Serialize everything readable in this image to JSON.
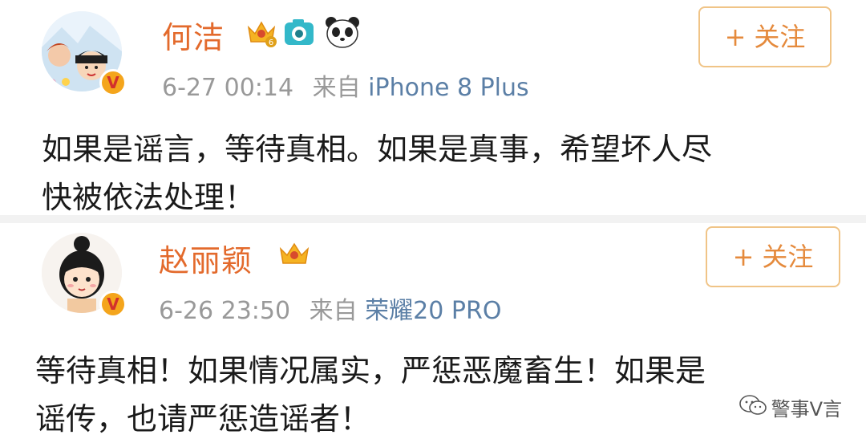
{
  "posts": [
    {
      "name": "何洁",
      "time": "6-27 00:14",
      "source_prefix": "来自",
      "source": "iPhone 8 Plus",
      "follow_label": "关注",
      "content_line1": "如果是谣言，等待真相。如果是真事，希望坏人尽",
      "content_line2": "快被依法处理！",
      "badges": [
        "crown-level-badge",
        "camera-badge",
        "panda-badge"
      ]
    },
    {
      "name": "赵丽颖",
      "time": "6-26 23:50",
      "source_prefix": "来自",
      "source": "荣耀20 PRO",
      "follow_label": "关注",
      "content_line1": "等待真相！如果情况属实，严惩恶魔畜生！如果是",
      "content_line2": "谣传，也请严惩造谣者！",
      "badges": [
        "crown-badge"
      ]
    }
  ],
  "watermark": {
    "text": "警事V言",
    "icon": "wechat-icon"
  },
  "colors": {
    "name": "#e36a2c",
    "meta": "#999999",
    "source": "#5b7fa6",
    "follow_border": "#f0c487",
    "follow_text": "#e58a3c",
    "verified_badge": "#f4a51c"
  }
}
